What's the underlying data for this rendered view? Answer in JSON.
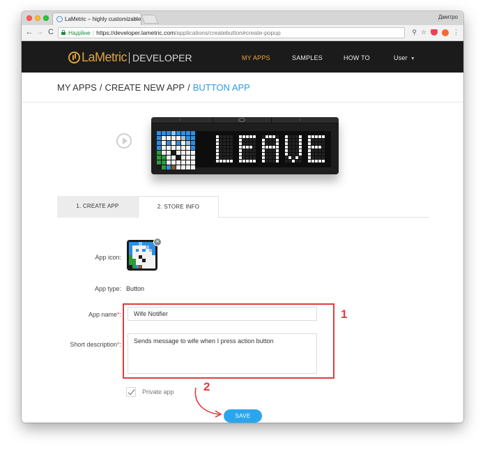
{
  "browser": {
    "tab_title": "LaMetric – highly customizable",
    "tab_close": "×",
    "user_label": "Дмитро",
    "nav_back": "←",
    "nav_forward": "→",
    "nav_reload": "C",
    "secure_label": "Надійне",
    "url_host": "https://developer.lametric.com",
    "url_path": "/applications/createbutton#create-popup",
    "ext_icons": [
      "key-icon",
      "star-icon",
      "pocket-icon",
      "extension-icon",
      "menu-icon"
    ],
    "ext_key": "⚲",
    "ext_star": "☆",
    "ext_menu": "⋮"
  },
  "site": {
    "logo_name": "LaMetric",
    "logo_sub": "DEVELOPER",
    "nav": [
      {
        "label": "MY APPS",
        "active": true
      },
      {
        "label": "SAMPLES",
        "active": false
      },
      {
        "label": "HOW TO",
        "active": false
      },
      {
        "label": "User",
        "active": false
      }
    ],
    "user_caret": "▼"
  },
  "breadcrumb": {
    "part1": "MY APPS",
    "part2": "CREATE NEW APP",
    "current": "BUTTON APP",
    "sep": "/"
  },
  "device": {
    "display_text": "LEAVE",
    "nav_left": "‹",
    "nav_right": "›"
  },
  "steps": [
    {
      "label": "1. CREATE APP",
      "active": false
    },
    {
      "label": "2. STORE INFO",
      "active": true
    }
  ],
  "form": {
    "app_icon_label": "App icon:",
    "remove_icon": "×",
    "app_type_label": "App type:",
    "app_type_value": "Button",
    "app_name_label": "App name",
    "app_name_value": "Wife Notifier",
    "short_desc_label": "Short description",
    "short_desc_value": "Sends message to wife when I press action button",
    "required_mark": "*",
    "colon": ":",
    "private_label": "Private app",
    "private_checked": true,
    "save_label": "SAVE"
  },
  "annotations": {
    "callout_1": "1",
    "callout_2": "2",
    "color": "#e33b3b"
  },
  "colors": {
    "accent_blue": "#2aa6ef",
    "brand_orange": "#e0a33a",
    "header_bg": "#1b1b1b"
  }
}
